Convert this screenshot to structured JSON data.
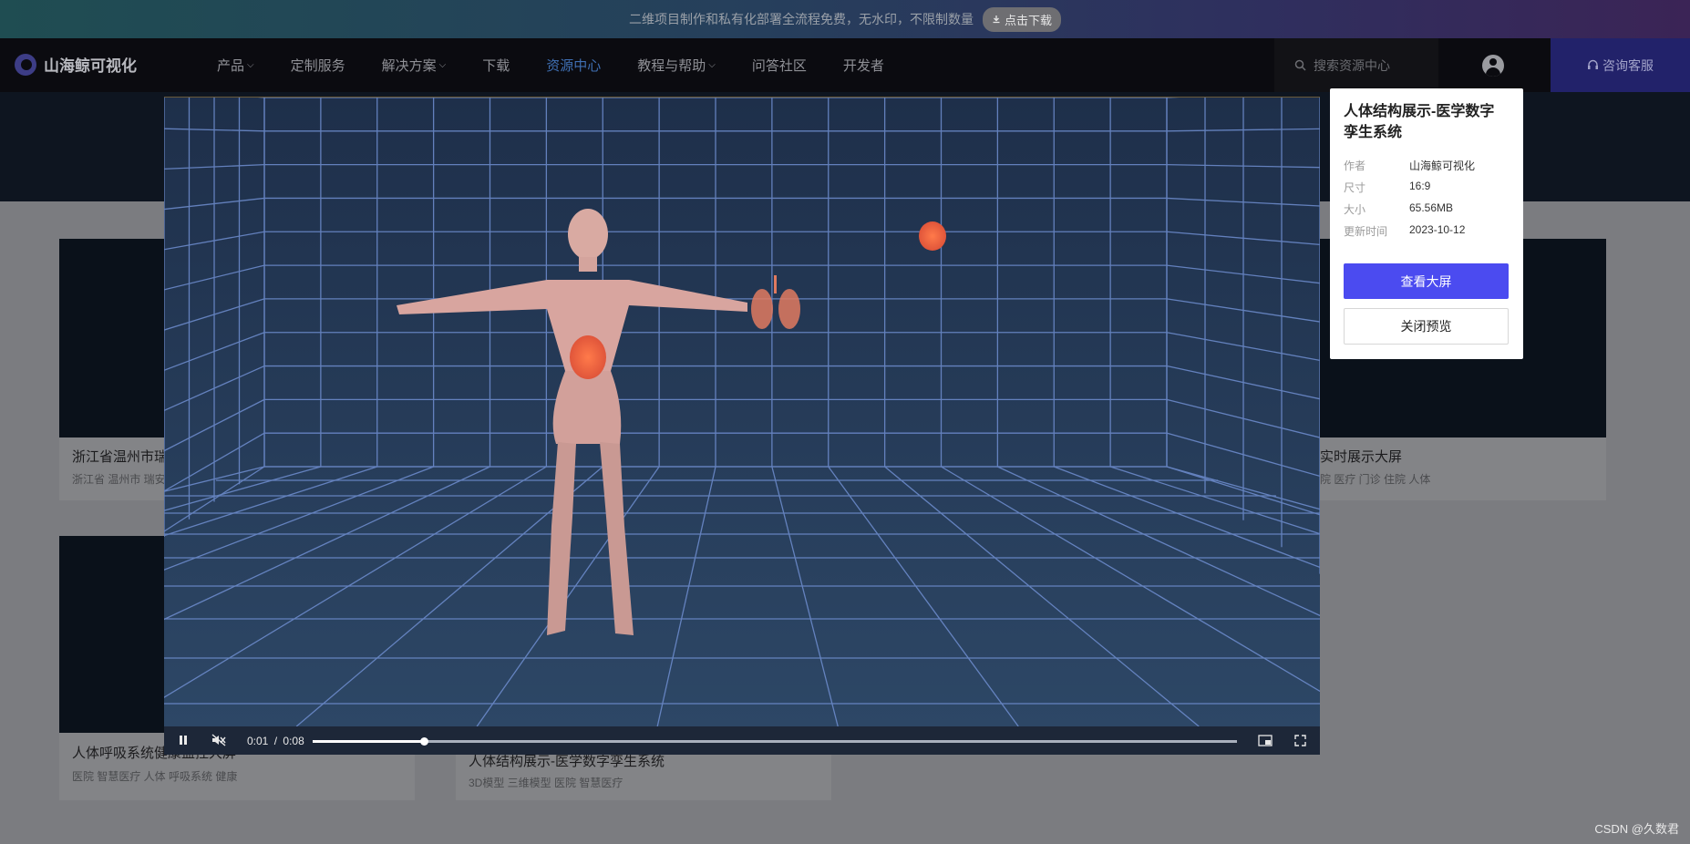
{
  "banner": {
    "text": "二维项目制作和私有化部署全流程免费，无水印，不限制数量",
    "button": "点击下载"
  },
  "nav": {
    "logo": "山海鲸可视化",
    "menu": [
      {
        "label": "产品",
        "dropdown": true,
        "active": false
      },
      {
        "label": "定制服务",
        "dropdown": false,
        "active": false
      },
      {
        "label": "解决方案",
        "dropdown": true,
        "active": false
      },
      {
        "label": "下载",
        "dropdown": false,
        "active": false
      },
      {
        "label": "资源中心",
        "dropdown": false,
        "active": true
      },
      {
        "label": "教程与帮助",
        "dropdown": true,
        "active": false
      },
      {
        "label": "问答社区",
        "dropdown": false,
        "active": false
      },
      {
        "label": "开发者",
        "dropdown": false,
        "active": false
      }
    ],
    "search_placeholder": "搜索资源中心",
    "consult": "咨询客服"
  },
  "cards": [
    {
      "title": "浙江省温州市瑞",
      "tags": "浙江省  温州市  瑞安"
    },
    {
      "title": "实时展示大屏",
      "tags": "院  医疗  门诊  住院  人体"
    },
    {
      "title": "人体呼吸系统健康监控大屏",
      "tags": "医院  智慧医疗  人体  呼吸系统  健康"
    },
    {
      "title": "人体结构展示-医学数字孪生系统",
      "tags": "3D模型  三维模型  医院  智慧医疗"
    }
  ],
  "video": {
    "current": "0:01",
    "separator": "/",
    "duration": "0:08",
    "progress": 0.12
  },
  "panel": {
    "title": "人体结构展示-医学数字孪生系统",
    "meta": [
      {
        "key": "作者",
        "value": "山海鲸可视化"
      },
      {
        "key": "尺寸",
        "value": "16:9"
      },
      {
        "key": "大小",
        "value": "65.56MB"
      },
      {
        "key": "更新时间",
        "value": "2023-10-12"
      }
    ],
    "primary_button": "查看大屏",
    "secondary_button": "关闭预览"
  },
  "colors": {
    "accent": "#4b4bf0",
    "nav_active": "#3f6fb3",
    "consult_bg": "#22226a"
  },
  "watermark": "CSDN @久数君"
}
